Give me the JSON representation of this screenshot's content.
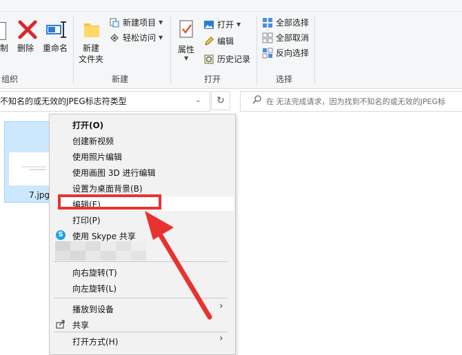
{
  "ribbon": {
    "organize": {
      "copy_partial": "制",
      "delete": "删除",
      "rename": "重命名",
      "label": "组织"
    },
    "new": {
      "new_folder_line1": "新建",
      "new_folder_line2": "文件夹",
      "new_item": "新建项目",
      "easy_access": "轻松访问",
      "label": "新建"
    },
    "open": {
      "properties": "属性",
      "open": "打开",
      "edit": "编辑",
      "history": "历史记录",
      "label": "打开"
    },
    "select": {
      "select_all": "全部选择",
      "select_none": "全部取消",
      "invert": "反向选择",
      "label": "选择"
    }
  },
  "address": {
    "text": "不知名的或无效的JPEG标志符类型"
  },
  "search": {
    "placeholder": "在 无法完成请求，因为找到不知名的或无效的JPEG标"
  },
  "file": {
    "name": "7.jpg"
  },
  "context_menu": {
    "items": [
      {
        "label": "打开(O)"
      },
      {
        "label": "创建新视频"
      },
      {
        "label": "使用照片编辑"
      },
      {
        "label": "使用画图 3D 进行编辑"
      },
      {
        "label": "设置为桌面背景(B)"
      },
      {
        "label": "编辑(E)"
      },
      {
        "label": "打印(P)"
      },
      {
        "label": "使用 Skype 共享"
      },
      {
        "label": "向右旋转(T)"
      },
      {
        "label": "向左旋转(L)"
      },
      {
        "label": "播放到设备"
      },
      {
        "label": "共享"
      },
      {
        "label": "打开方式(H)"
      }
    ]
  },
  "colors": {
    "annotation_red": "#e8322f",
    "selection_blue": "#cce8ff"
  }
}
